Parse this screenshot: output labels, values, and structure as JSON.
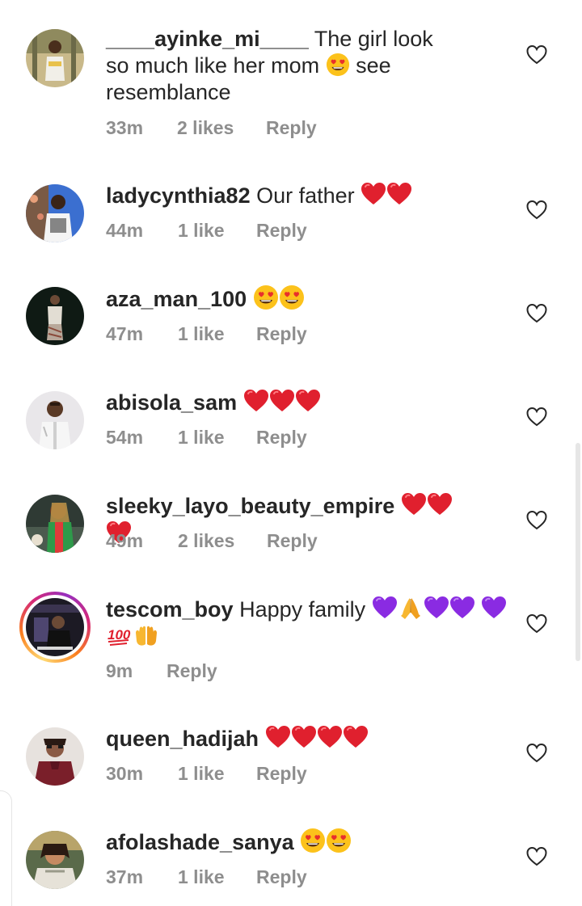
{
  "comments": [
    {
      "username": "____ayinke_mi____",
      "text": "The girl look so much like her mom",
      "text_after": "see resemblance",
      "emojis": [
        "heart-eyes"
      ],
      "time": "33m",
      "likes": "2 likes",
      "reply": "Reply"
    },
    {
      "username": "ladycynthia82",
      "text": "Our father",
      "emojis": [
        "red-heart",
        "red-heart"
      ],
      "time": "44m",
      "likes": "1 like",
      "reply": "Reply"
    },
    {
      "username": "aza_man_100",
      "text": "",
      "emojis": [
        "heart-eyes",
        "heart-eyes"
      ],
      "time": "47m",
      "likes": "1 like",
      "reply": "Reply"
    },
    {
      "username": "abisola_sam",
      "text": "",
      "emojis": [
        "red-heart",
        "red-heart",
        "red-heart"
      ],
      "time": "54m",
      "likes": "1 like",
      "reply": "Reply"
    },
    {
      "username": "sleeky_layo_beauty_empire",
      "text": "",
      "emojis": [
        "red-heart",
        "red-heart",
        "red-heart"
      ],
      "time": "49m",
      "likes": "2 likes",
      "reply": "Reply"
    },
    {
      "username": "tescom_boy",
      "text": "Happy family",
      "emojis": [
        "purple-heart",
        "folded-hands",
        "purple-heart",
        "purple-heart",
        "purple-heart",
        "hundred-points",
        "raised-hands"
      ],
      "time": "9m",
      "likes": "",
      "reply": "Reply"
    },
    {
      "username": "queen_hadijah",
      "text": "",
      "emojis": [
        "red-heart",
        "red-heart",
        "red-heart",
        "red-heart"
      ],
      "time": "30m",
      "likes": "1 like",
      "reply": "Reply"
    },
    {
      "username": "afolashade_sanya",
      "text": "",
      "emojis": [
        "heart-eyes",
        "heart-eyes"
      ],
      "time": "37m",
      "likes": "1 like",
      "reply": "Reply"
    }
  ],
  "icons": {
    "like": "heart-outline-icon"
  },
  "colors": {
    "text": "#262626",
    "meta": "#8e8e8e",
    "red_heart": "#e0202e",
    "purple_heart": "#8a2be2"
  }
}
